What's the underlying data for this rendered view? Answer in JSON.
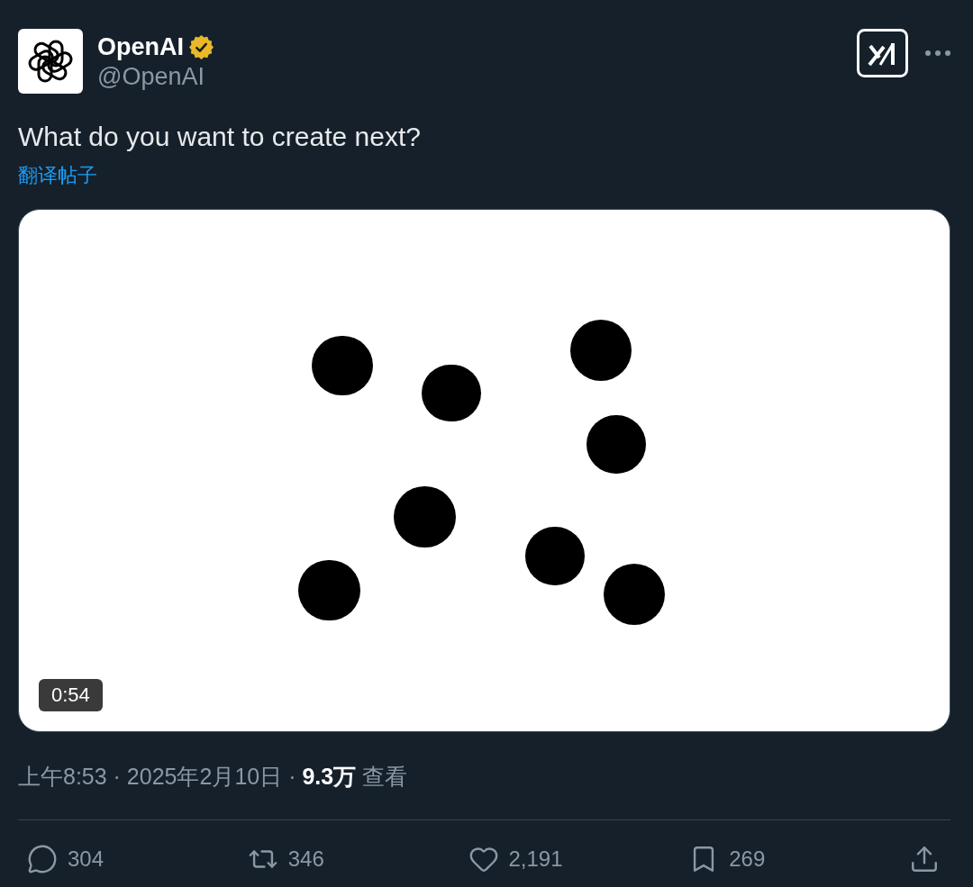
{
  "author": {
    "name": "OpenAI",
    "verified": true,
    "handle": "@OpenAI"
  },
  "post": {
    "text": "What do you want to create next?",
    "translate_link": "翻译帖子"
  },
  "video": {
    "duration": "0:54"
  },
  "meta": "上午8:53 · 2025年2月10日 · **9.3万** 查看",
  "actions": [
    {
      "kind": "reply",
      "count": "304"
    },
    {
      "kind": "repost",
      "count": "346"
    },
    {
      "kind": "like",
      "count": "2,191"
    },
    {
      "kind": "bookmark",
      "count": "269"
    },
    {
      "kind": "share"
    }
  ]
}
